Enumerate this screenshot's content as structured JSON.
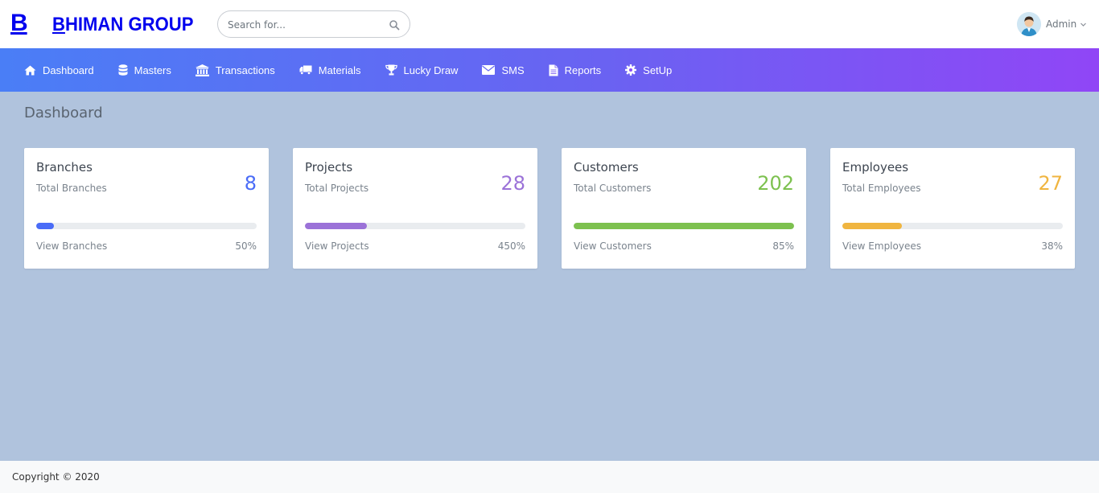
{
  "brand": {
    "mark": "B",
    "name_first": "B",
    "name_rest": "HIMAN GROUP",
    "color": "#0000ee"
  },
  "search": {
    "placeholder": "Search for...",
    "value": "",
    "icon": "search-icon"
  },
  "user": {
    "name": "Admin",
    "icon": "chevron-down-icon"
  },
  "nav": {
    "items": [
      {
        "label": "Dashboard",
        "icon": "home-icon"
      },
      {
        "label": "Masters",
        "icon": "database-icon"
      },
      {
        "label": "Transactions",
        "icon": "bank-icon"
      },
      {
        "label": "Materials",
        "icon": "truck-icon"
      },
      {
        "label": "Lucky Draw",
        "icon": "trophy-icon"
      },
      {
        "label": "SMS",
        "icon": "envelope-icon"
      },
      {
        "label": "Reports",
        "icon": "file-icon"
      },
      {
        "label": "SetUp",
        "icon": "gear-icon"
      }
    ]
  },
  "page": {
    "title": "Dashboard"
  },
  "cards": [
    {
      "title": "Branches",
      "subtitle": "Total Branches",
      "value": "8",
      "link": "View Branches",
      "percent": "50%",
      "fill_fraction": 0.08,
      "color": "#4a6cf7"
    },
    {
      "title": "Projects",
      "subtitle": "Total Projects",
      "value": "28",
      "link": "View Projects",
      "percent": "450%",
      "fill_fraction": 0.28,
      "color": "#9b72d8"
    },
    {
      "title": "Customers",
      "subtitle": "Total Customers",
      "value": "202",
      "link": "View Customers",
      "percent": "85%",
      "fill_fraction": 1.0,
      "color": "#7dc14f"
    },
    {
      "title": "Employees",
      "subtitle": "Total Employees",
      "value": "27",
      "link": "View Employees",
      "percent": "38%",
      "fill_fraction": 0.27,
      "color": "#f0b540"
    }
  ],
  "footer": {
    "text": "Copyright © 2020"
  }
}
